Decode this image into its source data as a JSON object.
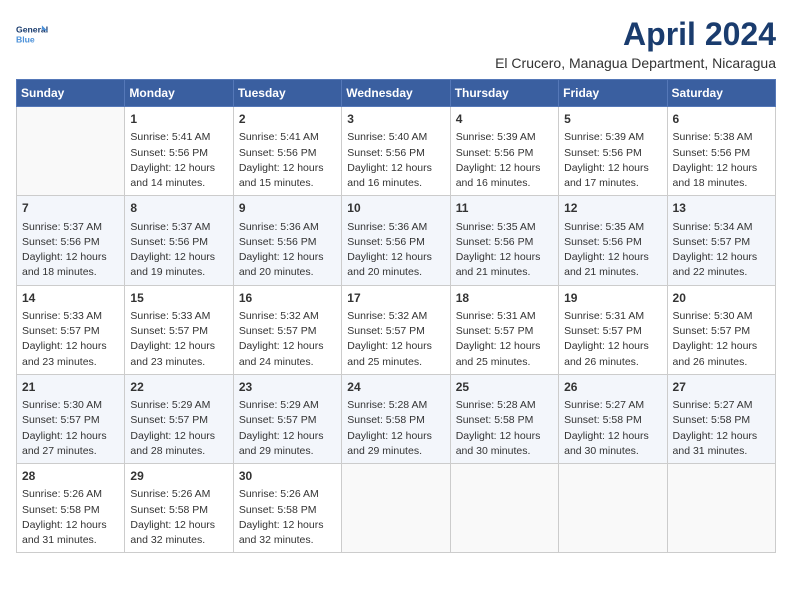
{
  "logo": {
    "line1": "General",
    "line2": "Blue"
  },
  "title": "April 2024",
  "subtitle": "El Crucero, Managua Department, Nicaragua",
  "weekdays": [
    "Sunday",
    "Monday",
    "Tuesday",
    "Wednesday",
    "Thursday",
    "Friday",
    "Saturday"
  ],
  "weeks": [
    [
      {
        "day": "",
        "info": ""
      },
      {
        "day": "1",
        "info": "Sunrise: 5:41 AM\nSunset: 5:56 PM\nDaylight: 12 hours\nand 14 minutes."
      },
      {
        "day": "2",
        "info": "Sunrise: 5:41 AM\nSunset: 5:56 PM\nDaylight: 12 hours\nand 15 minutes."
      },
      {
        "day": "3",
        "info": "Sunrise: 5:40 AM\nSunset: 5:56 PM\nDaylight: 12 hours\nand 16 minutes."
      },
      {
        "day": "4",
        "info": "Sunrise: 5:39 AM\nSunset: 5:56 PM\nDaylight: 12 hours\nand 16 minutes."
      },
      {
        "day": "5",
        "info": "Sunrise: 5:39 AM\nSunset: 5:56 PM\nDaylight: 12 hours\nand 17 minutes."
      },
      {
        "day": "6",
        "info": "Sunrise: 5:38 AM\nSunset: 5:56 PM\nDaylight: 12 hours\nand 18 minutes."
      }
    ],
    [
      {
        "day": "7",
        "info": "Sunrise: 5:37 AM\nSunset: 5:56 PM\nDaylight: 12 hours\nand 18 minutes."
      },
      {
        "day": "8",
        "info": "Sunrise: 5:37 AM\nSunset: 5:56 PM\nDaylight: 12 hours\nand 19 minutes."
      },
      {
        "day": "9",
        "info": "Sunrise: 5:36 AM\nSunset: 5:56 PM\nDaylight: 12 hours\nand 20 minutes."
      },
      {
        "day": "10",
        "info": "Sunrise: 5:36 AM\nSunset: 5:56 PM\nDaylight: 12 hours\nand 20 minutes."
      },
      {
        "day": "11",
        "info": "Sunrise: 5:35 AM\nSunset: 5:56 PM\nDaylight: 12 hours\nand 21 minutes."
      },
      {
        "day": "12",
        "info": "Sunrise: 5:35 AM\nSunset: 5:56 PM\nDaylight: 12 hours\nand 21 minutes."
      },
      {
        "day": "13",
        "info": "Sunrise: 5:34 AM\nSunset: 5:57 PM\nDaylight: 12 hours\nand 22 minutes."
      }
    ],
    [
      {
        "day": "14",
        "info": "Sunrise: 5:33 AM\nSunset: 5:57 PM\nDaylight: 12 hours\nand 23 minutes."
      },
      {
        "day": "15",
        "info": "Sunrise: 5:33 AM\nSunset: 5:57 PM\nDaylight: 12 hours\nand 23 minutes."
      },
      {
        "day": "16",
        "info": "Sunrise: 5:32 AM\nSunset: 5:57 PM\nDaylight: 12 hours\nand 24 minutes."
      },
      {
        "day": "17",
        "info": "Sunrise: 5:32 AM\nSunset: 5:57 PM\nDaylight: 12 hours\nand 25 minutes."
      },
      {
        "day": "18",
        "info": "Sunrise: 5:31 AM\nSunset: 5:57 PM\nDaylight: 12 hours\nand 25 minutes."
      },
      {
        "day": "19",
        "info": "Sunrise: 5:31 AM\nSunset: 5:57 PM\nDaylight: 12 hours\nand 26 minutes."
      },
      {
        "day": "20",
        "info": "Sunrise: 5:30 AM\nSunset: 5:57 PM\nDaylight: 12 hours\nand 26 minutes."
      }
    ],
    [
      {
        "day": "21",
        "info": "Sunrise: 5:30 AM\nSunset: 5:57 PM\nDaylight: 12 hours\nand 27 minutes."
      },
      {
        "day": "22",
        "info": "Sunrise: 5:29 AM\nSunset: 5:57 PM\nDaylight: 12 hours\nand 28 minutes."
      },
      {
        "day": "23",
        "info": "Sunrise: 5:29 AM\nSunset: 5:57 PM\nDaylight: 12 hours\nand 29 minutes."
      },
      {
        "day": "24",
        "info": "Sunrise: 5:28 AM\nSunset: 5:58 PM\nDaylight: 12 hours\nand 29 minutes."
      },
      {
        "day": "25",
        "info": "Sunrise: 5:28 AM\nSunset: 5:58 PM\nDaylight: 12 hours\nand 30 minutes."
      },
      {
        "day": "26",
        "info": "Sunrise: 5:27 AM\nSunset: 5:58 PM\nDaylight: 12 hours\nand 30 minutes."
      },
      {
        "day": "27",
        "info": "Sunrise: 5:27 AM\nSunset: 5:58 PM\nDaylight: 12 hours\nand 31 minutes."
      }
    ],
    [
      {
        "day": "28",
        "info": "Sunrise: 5:26 AM\nSunset: 5:58 PM\nDaylight: 12 hours\nand 31 minutes."
      },
      {
        "day": "29",
        "info": "Sunrise: 5:26 AM\nSunset: 5:58 PM\nDaylight: 12 hours\nand 32 minutes."
      },
      {
        "day": "30",
        "info": "Sunrise: 5:26 AM\nSunset: 5:58 PM\nDaylight: 12 hours\nand 32 minutes."
      },
      {
        "day": "",
        "info": ""
      },
      {
        "day": "",
        "info": ""
      },
      {
        "day": "",
        "info": ""
      },
      {
        "day": "",
        "info": ""
      }
    ]
  ]
}
